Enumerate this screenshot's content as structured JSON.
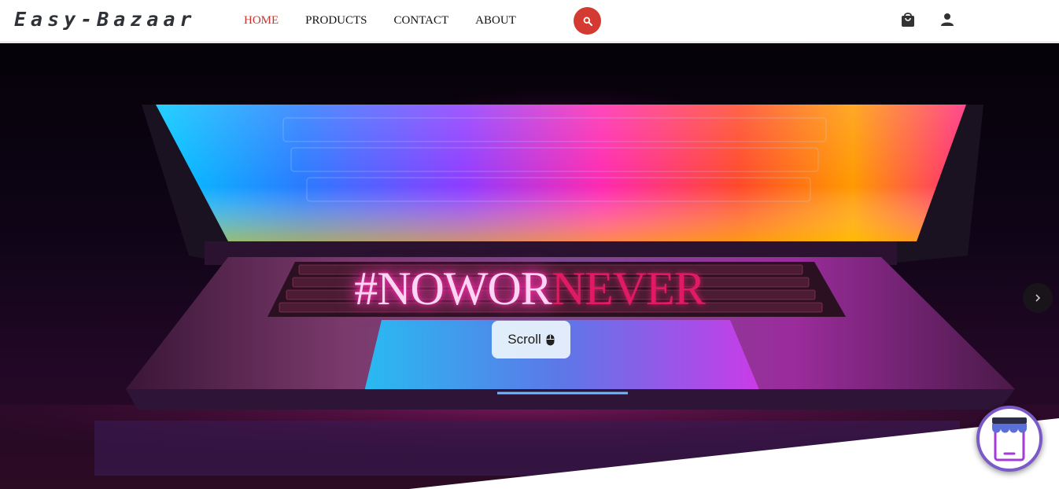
{
  "header": {
    "logo": "Easy-Bazaar",
    "nav": [
      {
        "label": "HOME",
        "active": true
      },
      {
        "label": "PRODUCTS",
        "active": false
      },
      {
        "label": "CONTACT",
        "active": false
      },
      {
        "label": "ABOUT",
        "active": false
      }
    ],
    "icons": [
      "search-icon",
      "shopping-bag-icon",
      "user-icon"
    ]
  },
  "hero": {
    "slogan_part1": "#NOWOR",
    "slogan_part2": "NEVER",
    "scroll_label": "Scroll",
    "scroll_icon": "mouse-icon",
    "next_icon": "chevron-right-icon"
  },
  "floating": {
    "icon": "storefront-icon"
  },
  "colors": {
    "accent": "#c8322b",
    "search_button": "#d23a32",
    "slogan_glow": "#ff2aa8",
    "slogan_red": "#e01b63",
    "badge_border": "#7a5ac8"
  }
}
